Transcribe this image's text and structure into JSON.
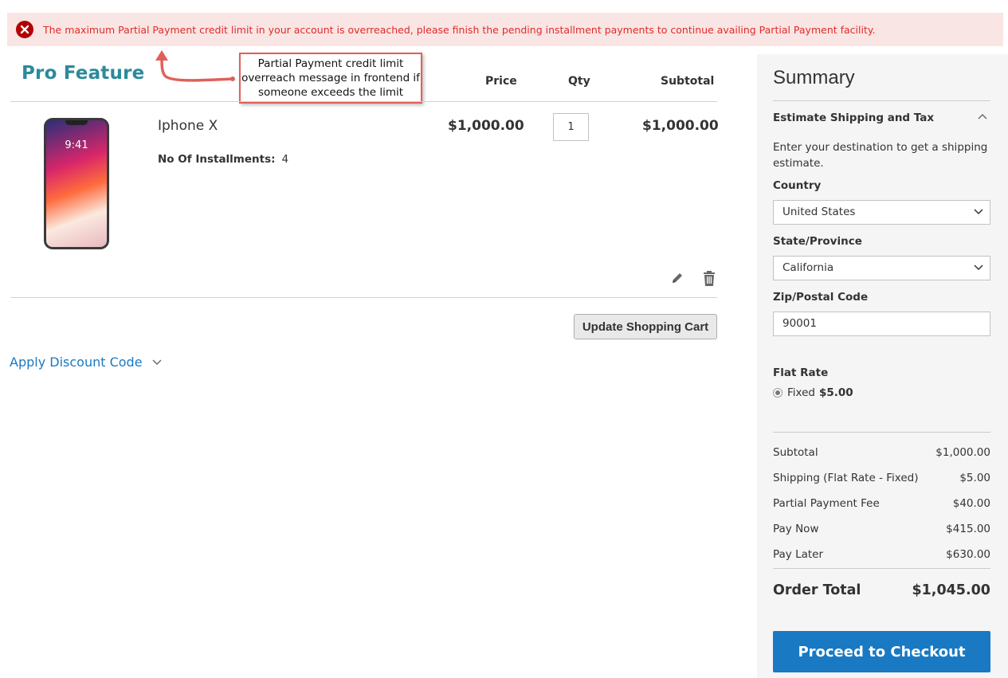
{
  "alert": {
    "message": "The maximum Partial Payment credit limit in your account is overreached, please finish the pending installment payments to continue availing Partial Payment facility."
  },
  "pro_label": "Pro Feature",
  "callout": {
    "line1": "Partial Payment credit limit",
    "line2": "overreach message in frontend if",
    "line3": "someone exceeds the limit"
  },
  "cart": {
    "headers": {
      "price": "Price",
      "qty": "Qty",
      "subtotal": "Subtotal"
    },
    "item": {
      "name": "Iphone X",
      "clock": "9:41",
      "option_label": "No Of Installments:",
      "option_value": "4",
      "price": "$1,000.00",
      "qty": "1",
      "subtotal": "$1,000.00"
    },
    "update_label": "Update Shopping Cart",
    "discount_label": "Apply Discount Code"
  },
  "summary": {
    "title": "Summary",
    "estimate_title": "Estimate Shipping and Tax",
    "estimate_desc": "Enter your destination to get a shipping estimate.",
    "country_label": "Country",
    "country_value": "United States",
    "state_label": "State/Province",
    "state_value": "California",
    "zip_label": "Zip/Postal Code",
    "zip_value": "90001",
    "rate_title": "Flat Rate",
    "rate_option": "Fixed",
    "rate_price": "$5.00",
    "totals": [
      {
        "label": "Subtotal",
        "value": "$1,000.00"
      },
      {
        "label": "Shipping (Flat Rate - Fixed)",
        "value": "$5.00"
      },
      {
        "label": "Partial Payment Fee",
        "value": "$40.00"
      },
      {
        "label": "Pay Now",
        "value": "$415.00"
      },
      {
        "label": "Pay Later",
        "value": "$630.00"
      }
    ],
    "order_total_label": "Order Total",
    "order_total_value": "$1,045.00",
    "checkout_label": "Proceed to Checkout"
  },
  "colors": {
    "alert_bg": "#fae5e5",
    "alert_text": "#e02b27",
    "link": "#1979c3",
    "checkout": "#1979c3",
    "pro": "#2c8a9b",
    "callout_border": "#e0605a"
  }
}
